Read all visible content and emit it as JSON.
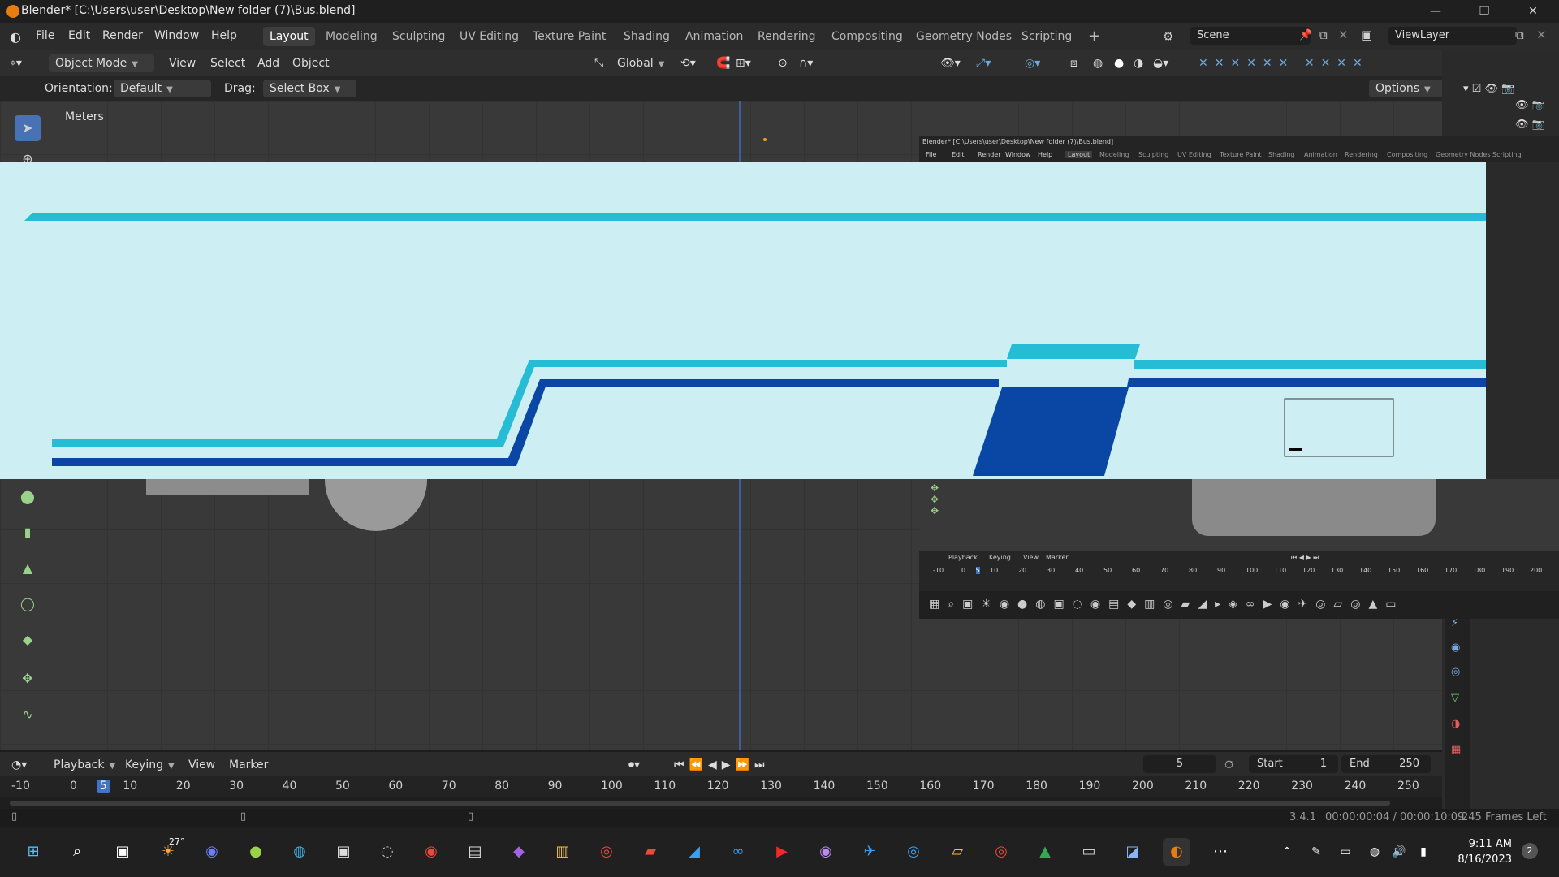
{
  "window": {
    "title": "Blender* [C:\\Users\\user\\Desktop\\New folder (7)\\Bus.blend]",
    "minimize": "—",
    "maximize": "❐",
    "close": "✕"
  },
  "menu": [
    "File",
    "Edit",
    "Render",
    "Window",
    "Help"
  ],
  "workspaces": [
    "Layout",
    "Modeling",
    "Sculpting",
    "UV Editing",
    "Texture Paint",
    "Shading",
    "Animation",
    "Rendering",
    "Compositing",
    "Geometry Nodes",
    "Scripting"
  ],
  "active_workspace": "Layout",
  "add_workspace": "+",
  "scene": {
    "label": "Scene",
    "viewlayer": "ViewLayer"
  },
  "header": {
    "mode": "Object Mode",
    "view": "View",
    "select": "Select",
    "add": "Add",
    "object": "Object",
    "transform": "Global",
    "options": "Options"
  },
  "toolsettings": {
    "orientation_label": "Orientation:",
    "orientation_value": "Default",
    "drag_label": "Drag:",
    "drag_value": "Select Box"
  },
  "viewport": {
    "units": "Meters"
  },
  "timeline": {
    "playback": "Playback",
    "keying": "Keying",
    "view": "View",
    "marker": "Marker",
    "current_frame": "5",
    "start_label": "Start",
    "start": "1",
    "end_label": "End",
    "end": "250",
    "ticks": [
      "-10",
      "0",
      "5",
      "10",
      "20",
      "30",
      "40",
      "50",
      "60",
      "70",
      "80",
      "90",
      "100",
      "110",
      "120",
      "130",
      "140",
      "150",
      "160",
      "170",
      "180",
      "190",
      "200",
      "210",
      "220",
      "230",
      "240",
      "250"
    ]
  },
  "status": {
    "version": "3.4.1",
    "time": "00:00:00:04 / 00:00:10:09",
    "frames_left": "245 Frames Left"
  },
  "nested": {
    "title": "Blender* [C:\\Users\\user\\Desktop\\New folder (7)\\Bus.blend]",
    "menu": [
      "File",
      "Edit",
      "Render",
      "Window",
      "Help"
    ],
    "workspaces": [
      "Layout",
      "Modeling",
      "Sculpting",
      "UV Editing",
      "Texture Paint",
      "Shading",
      "Animation",
      "Rendering",
      "Compositing",
      "Geometry Nodes",
      "Scripting"
    ],
    "timeline_labels": [
      "Playback",
      "Keying",
      "View",
      "Marker"
    ],
    "ticks": [
      "-10",
      "0",
      "5",
      "10",
      "20",
      "30",
      "40",
      "50",
      "60",
      "70",
      "80",
      "90",
      "100",
      "110",
      "120",
      "130",
      "140",
      "150",
      "160",
      "170",
      "180",
      "190",
      "200"
    ]
  },
  "taskbar": {
    "weather": "27°",
    "time": "9:11 AM",
    "date": "8/16/2023",
    "notifications": "2"
  },
  "colors": {
    "overlay_bg": "#cdeef3",
    "stripe_light": "#27bcd6",
    "stripe_dark": "#0a47a5",
    "accent": "#4472c4"
  }
}
